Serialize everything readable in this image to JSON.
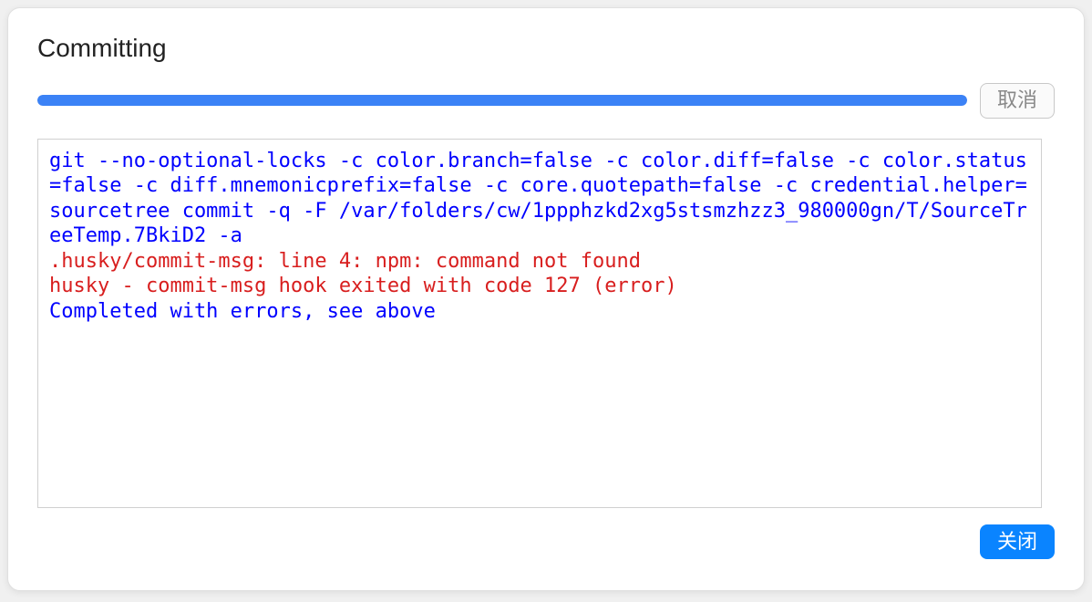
{
  "title": "Committing",
  "buttons": {
    "cancel": "取消",
    "close": "关闭"
  },
  "progress": {
    "percent": 100
  },
  "console": {
    "command": "git --no-optional-locks -c color.branch=false -c color.diff=false -c color.status=false -c diff.mnemonicprefix=false -c core.quotepath=false -c credential.helper=sourcetree commit -q -F /var/folders/cw/1ppphzkd2xg5stsmzhzz3_980000gn/T/SourceTreeTemp.7BkiD2 -a ",
    "error_line1": ".husky/commit-msg: line 4: npm: command not found",
    "error_line2": "husky - commit-msg hook exited with code 127 (error)",
    "completed": "Completed with errors, see above"
  }
}
